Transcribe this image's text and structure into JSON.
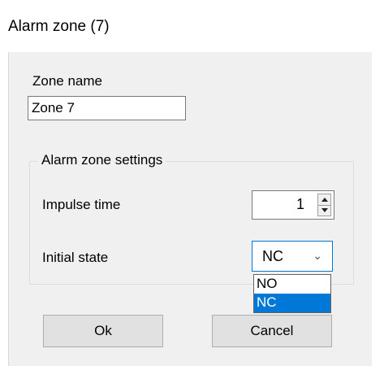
{
  "window": {
    "title": "Alarm zone (7)"
  },
  "zone_name": {
    "label": "Zone name",
    "value": "Zone 7"
  },
  "settings_group": {
    "legend": "Alarm zone settings",
    "impulse_time": {
      "label": "Impulse time",
      "value": "1"
    },
    "initial_state": {
      "label": "Initial state",
      "selected": "NC",
      "options": [
        "NO",
        "NC"
      ]
    }
  },
  "buttons": {
    "ok_label": "Ok",
    "cancel_label": "Cancel"
  },
  "colors": {
    "selection": "#0078d7",
    "dialog_background": "#f0f0f0"
  }
}
